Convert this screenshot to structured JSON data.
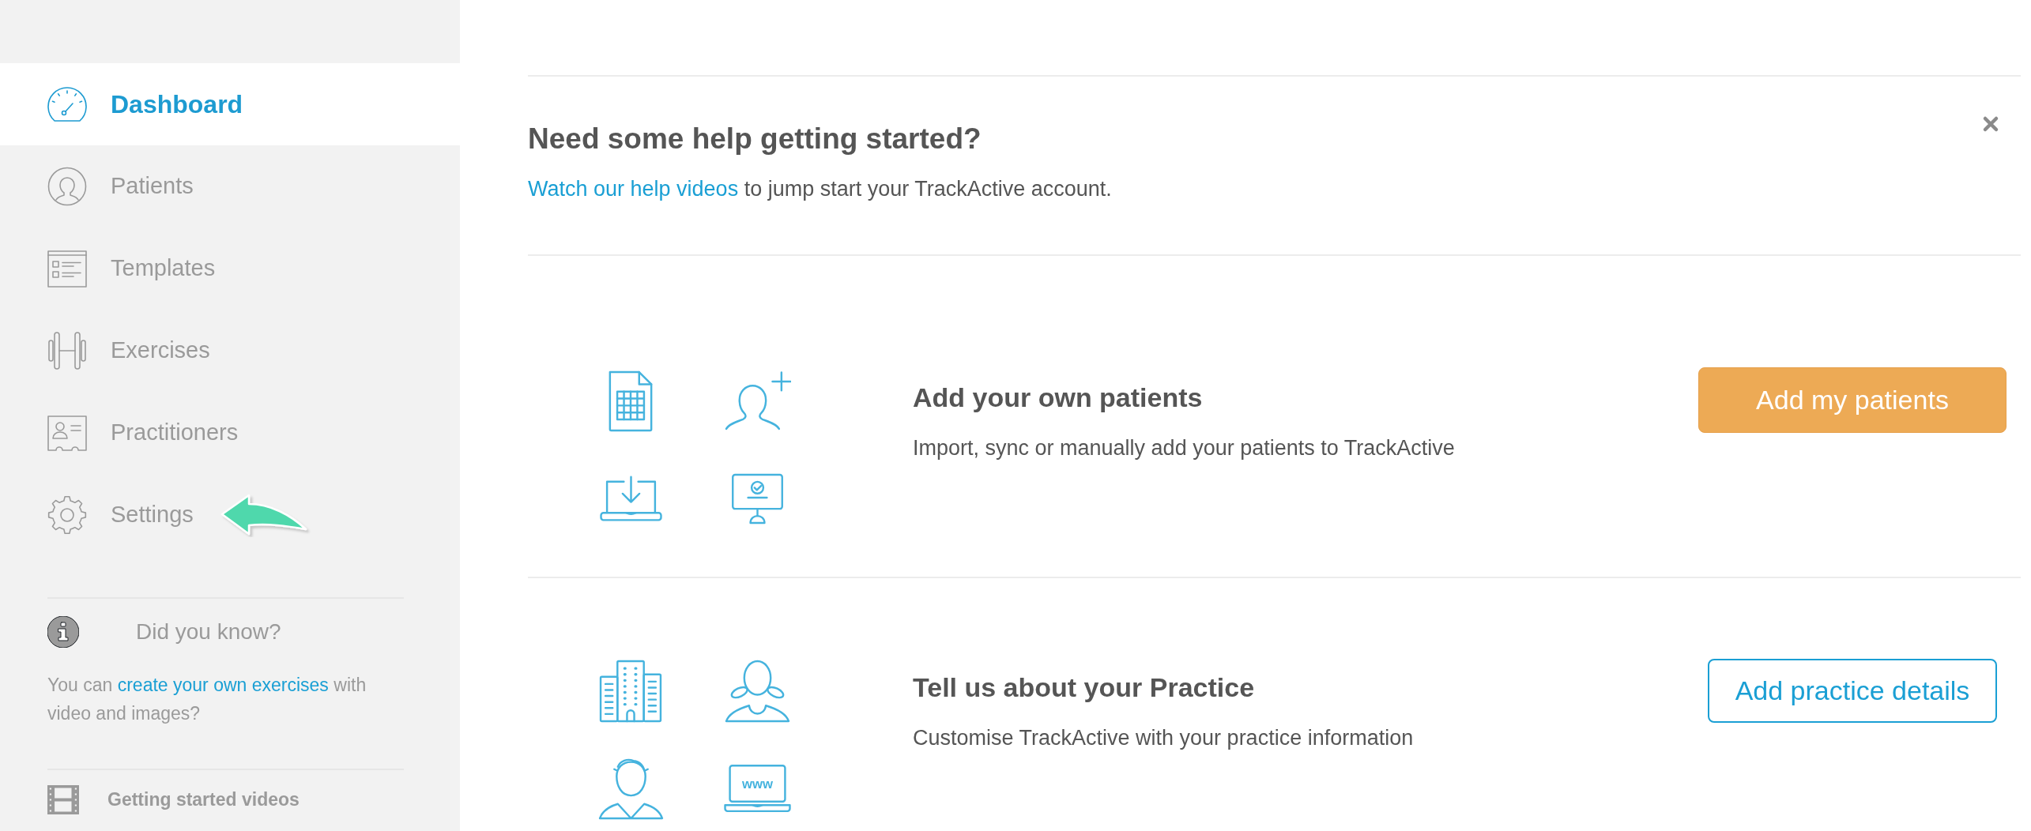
{
  "sidebar": {
    "nav_items": [
      {
        "label": "Dashboard",
        "selected": true,
        "pointed_at": false
      },
      {
        "label": "Patients",
        "selected": false,
        "pointed_at": false
      },
      {
        "label": "Templates",
        "selected": false,
        "pointed_at": false
      },
      {
        "label": "Exercises",
        "selected": false,
        "pointed_at": false
      },
      {
        "label": "Practitioners",
        "selected": false,
        "pointed_at": false
      },
      {
        "label": "Settings",
        "selected": false,
        "pointed_at": true
      }
    ],
    "tip": {
      "title": "Did you know?",
      "text_before": "You can ",
      "link": "create your own exercises",
      "text_after": " with video and images?"
    },
    "videos_link": "Getting started videos"
  },
  "help_banner": {
    "title": "Need some help getting started?",
    "link": "Watch our help videos",
    "text_after": " to jump start your TrackActive account."
  },
  "steps": [
    {
      "title": "Add your own patients",
      "description": "Import, sync or manually add your patients to TrackActive",
      "button": {
        "label": "Add my patients",
        "kind": "filled"
      }
    },
    {
      "title": "Tell us about your Practice",
      "description": "Customise TrackActive with your practice information",
      "button": {
        "label": "Add practice details",
        "kind": "outline"
      },
      "illustration_text": "www"
    }
  ]
}
